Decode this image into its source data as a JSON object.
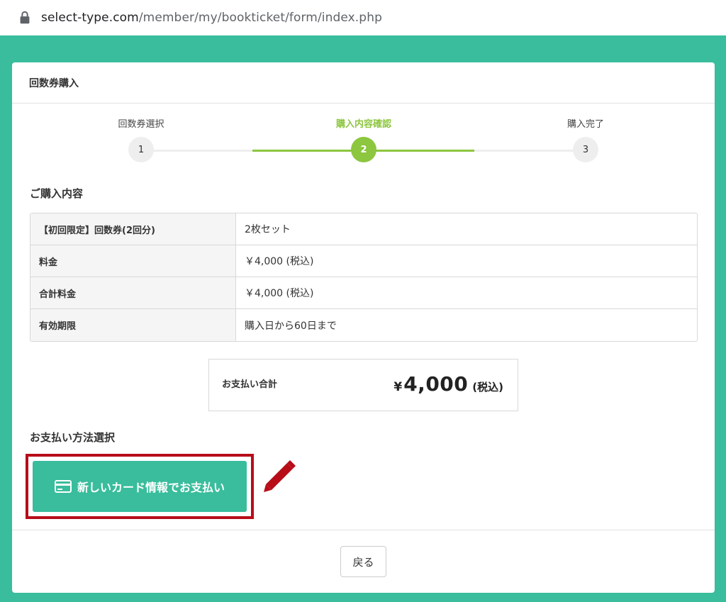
{
  "browser": {
    "url_host": "select-type.com",
    "url_path": "/member/my/bookticket/form/index.php"
  },
  "card": {
    "title": "回数券購入"
  },
  "stepper": {
    "steps": [
      {
        "label": "回数券選択",
        "number": "1",
        "active": false
      },
      {
        "label": "購入内容確認",
        "number": "2",
        "active": true
      },
      {
        "label": "購入完了",
        "number": "3",
        "active": false
      }
    ]
  },
  "purchase": {
    "heading": "ご購入内容",
    "rows": [
      {
        "label": "【初回限定】回数券(2回分)",
        "value": "2枚セット"
      },
      {
        "label": "料金",
        "value": "￥4,000 (税込)"
      },
      {
        "label": "合計料金",
        "value": "￥4,000 (税込)"
      },
      {
        "label": "有効期限",
        "value": "購入日から60日まで"
      }
    ]
  },
  "total": {
    "label": "お支払い合計",
    "currency": "¥",
    "amount": "4,000",
    "tax_note": "(税込)"
  },
  "payment": {
    "heading": "お支払い方法選択",
    "button_label": "新しいカード情報でお支払い"
  },
  "footer": {
    "back_label": "戻る"
  },
  "colors": {
    "brand_green": "#39bd9c",
    "step_active": "#8dc63f",
    "highlight_red": "#b70d18"
  }
}
